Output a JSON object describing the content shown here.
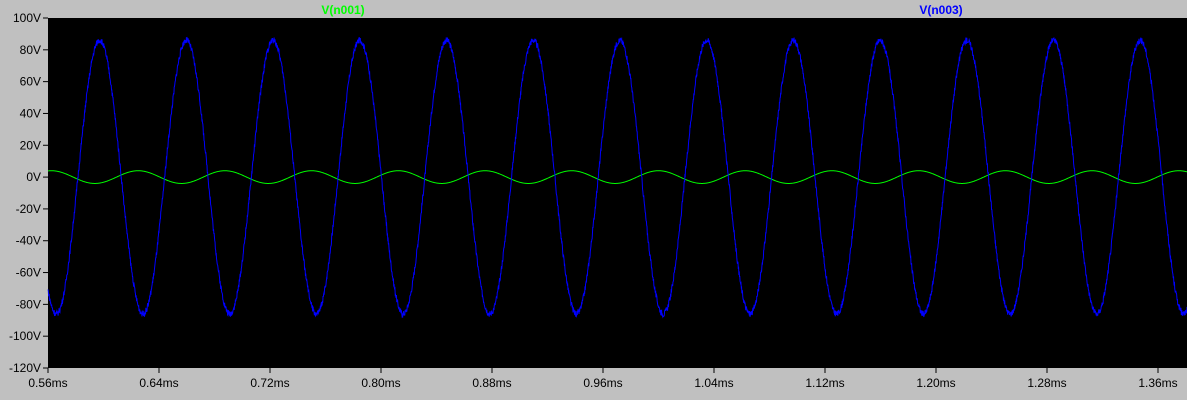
{
  "chart_data": {
    "type": "line",
    "title": "",
    "xlabel": "",
    "ylabel": "",
    "x_unit": "ms",
    "y_unit": "V",
    "xlim": [
      0.56,
      1.42
    ],
    "ylim": [
      -120,
      100
    ],
    "x_ticks": [
      "0.56ms",
      "0.64ms",
      "0.72ms",
      "0.80ms",
      "0.88ms",
      "0.96ms",
      "1.04ms",
      "1.12ms",
      "1.20ms",
      "1.28ms",
      "1.36ms"
    ],
    "x_tick_values": [
      0.56,
      0.64,
      0.72,
      0.8,
      0.88,
      0.96,
      1.04,
      1.12,
      1.2,
      1.28,
      1.36
    ],
    "y_ticks": [
      "100V",
      "80V",
      "60V",
      "40V",
      "20V",
      "0V",
      "-20V",
      "-40V",
      "-60V",
      "-80V",
      "-100V",
      "-120V"
    ],
    "y_tick_values": [
      100,
      80,
      60,
      40,
      20,
      0,
      -20,
      -40,
      -60,
      -80,
      -100,
      -120
    ],
    "grid": false,
    "legend_position": "top",
    "series": [
      {
        "name": "V(n001)",
        "color": "#00ff00",
        "waveform": "sine",
        "amplitude": 4,
        "period_ms": 0.0625,
        "peak_at_ms": 0.5625,
        "noise": 0
      },
      {
        "name": "V(n003)",
        "color": "#0000ff",
        "waveform": "sine",
        "amplitude": 86,
        "period_ms": 0.0625,
        "peak_at_ms": 0.5972,
        "noise": 2
      }
    ]
  }
}
